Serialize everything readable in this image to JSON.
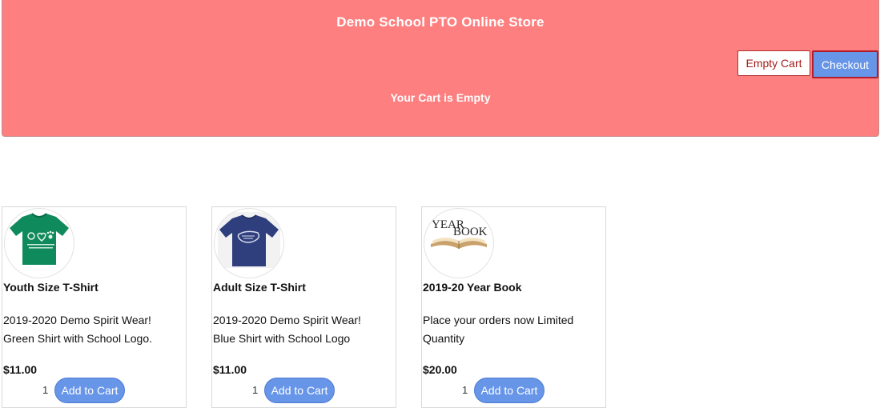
{
  "header": {
    "store_title": "Demo School PTO Online Store",
    "cart_status": "Your Cart is Empty",
    "empty_cart_label": "Empty Cart",
    "checkout_label": "Checkout"
  },
  "products": [
    {
      "title": "Youth Size T-Shirt",
      "desc_line1": "2019-2020 Demo Spirit Wear!",
      "desc_line2": "Green Shirt with School Logo.",
      "price": "$11.00",
      "qty": "1",
      "add_label": "Add to Cart",
      "image": "green-tshirt"
    },
    {
      "title": "Adult Size T-Shirt",
      "desc_line1": "2019-2020 Demo Spirit Wear!",
      "desc_line2": "Blue Shirt with School Logo",
      "price": "$11.00",
      "qty": "1",
      "add_label": "Add to Cart",
      "image": "blue-tshirt"
    },
    {
      "title": "2019-20 Year Book",
      "desc_line1": "Place your orders now Limited",
      "desc_line2": "Quantity",
      "price": "$20.00",
      "qty": "1",
      "add_label": "Add to Cart",
      "image": "yearbook",
      "image_text_1": "YEAR",
      "image_text_2": "BOOK"
    }
  ],
  "colors": {
    "header_bg": "#fe7f7f",
    "button_blue": "#6795e8",
    "accent_red": "#b31d2a"
  }
}
